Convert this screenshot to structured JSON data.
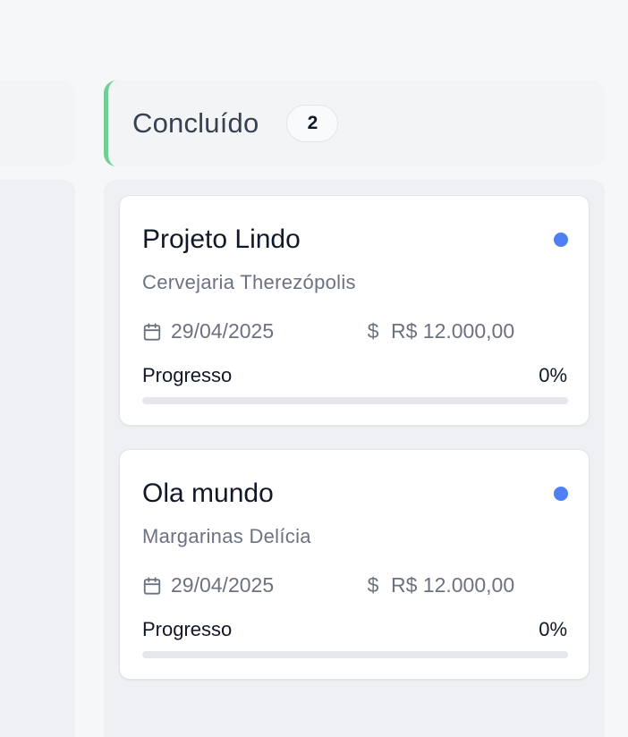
{
  "column": {
    "title": "Concluído",
    "count": "2",
    "accent_color": "#6fcf97"
  },
  "cards": [
    {
      "title": "Projeto Lindo",
      "client": "Cervejaria Therezópolis",
      "date": "29/04/2025",
      "value": "R$ 12.000,00",
      "progress_label": "Progresso",
      "progress_text": "0%",
      "progress": 0,
      "status_color": "#4f7ff0"
    },
    {
      "title": "Ola mundo",
      "client": "Margarinas Delícia",
      "date": "29/04/2025",
      "value": "R$ 12.000,00",
      "progress_label": "Progresso",
      "progress_text": "0%",
      "progress": 0,
      "status_color": "#4f7ff0"
    }
  ],
  "icons": {
    "date": "calendar-icon",
    "value": "dollar-icon",
    "value_glyph": "$"
  }
}
